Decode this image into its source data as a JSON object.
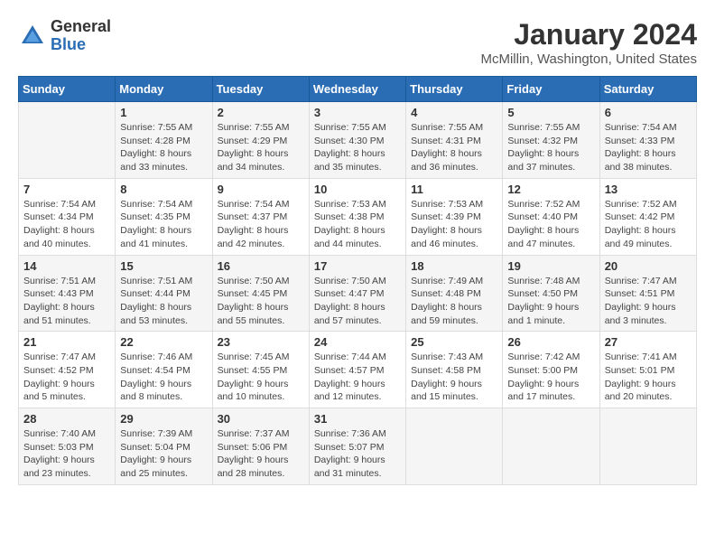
{
  "header": {
    "logo_general": "General",
    "logo_blue": "Blue",
    "title": "January 2024",
    "location": "McMillin, Washington, United States"
  },
  "weekdays": [
    "Sunday",
    "Monday",
    "Tuesday",
    "Wednesday",
    "Thursday",
    "Friday",
    "Saturday"
  ],
  "weeks": [
    [
      {
        "day": "",
        "sunrise": "",
        "sunset": "",
        "daylight": ""
      },
      {
        "day": "1",
        "sunrise": "Sunrise: 7:55 AM",
        "sunset": "Sunset: 4:28 PM",
        "daylight": "Daylight: 8 hours and 33 minutes."
      },
      {
        "day": "2",
        "sunrise": "Sunrise: 7:55 AM",
        "sunset": "Sunset: 4:29 PM",
        "daylight": "Daylight: 8 hours and 34 minutes."
      },
      {
        "day": "3",
        "sunrise": "Sunrise: 7:55 AM",
        "sunset": "Sunset: 4:30 PM",
        "daylight": "Daylight: 8 hours and 35 minutes."
      },
      {
        "day": "4",
        "sunrise": "Sunrise: 7:55 AM",
        "sunset": "Sunset: 4:31 PM",
        "daylight": "Daylight: 8 hours and 36 minutes."
      },
      {
        "day": "5",
        "sunrise": "Sunrise: 7:55 AM",
        "sunset": "Sunset: 4:32 PM",
        "daylight": "Daylight: 8 hours and 37 minutes."
      },
      {
        "day": "6",
        "sunrise": "Sunrise: 7:54 AM",
        "sunset": "Sunset: 4:33 PM",
        "daylight": "Daylight: 8 hours and 38 minutes."
      }
    ],
    [
      {
        "day": "7",
        "sunrise": "Sunrise: 7:54 AM",
        "sunset": "Sunset: 4:34 PM",
        "daylight": "Daylight: 8 hours and 40 minutes."
      },
      {
        "day": "8",
        "sunrise": "Sunrise: 7:54 AM",
        "sunset": "Sunset: 4:35 PM",
        "daylight": "Daylight: 8 hours and 41 minutes."
      },
      {
        "day": "9",
        "sunrise": "Sunrise: 7:54 AM",
        "sunset": "Sunset: 4:37 PM",
        "daylight": "Daylight: 8 hours and 42 minutes."
      },
      {
        "day": "10",
        "sunrise": "Sunrise: 7:53 AM",
        "sunset": "Sunset: 4:38 PM",
        "daylight": "Daylight: 8 hours and 44 minutes."
      },
      {
        "day": "11",
        "sunrise": "Sunrise: 7:53 AM",
        "sunset": "Sunset: 4:39 PM",
        "daylight": "Daylight: 8 hours and 46 minutes."
      },
      {
        "day": "12",
        "sunrise": "Sunrise: 7:52 AM",
        "sunset": "Sunset: 4:40 PM",
        "daylight": "Daylight: 8 hours and 47 minutes."
      },
      {
        "day": "13",
        "sunrise": "Sunrise: 7:52 AM",
        "sunset": "Sunset: 4:42 PM",
        "daylight": "Daylight: 8 hours and 49 minutes."
      }
    ],
    [
      {
        "day": "14",
        "sunrise": "Sunrise: 7:51 AM",
        "sunset": "Sunset: 4:43 PM",
        "daylight": "Daylight: 8 hours and 51 minutes."
      },
      {
        "day": "15",
        "sunrise": "Sunrise: 7:51 AM",
        "sunset": "Sunset: 4:44 PM",
        "daylight": "Daylight: 8 hours and 53 minutes."
      },
      {
        "day": "16",
        "sunrise": "Sunrise: 7:50 AM",
        "sunset": "Sunset: 4:45 PM",
        "daylight": "Daylight: 8 hours and 55 minutes."
      },
      {
        "day": "17",
        "sunrise": "Sunrise: 7:50 AM",
        "sunset": "Sunset: 4:47 PM",
        "daylight": "Daylight: 8 hours and 57 minutes."
      },
      {
        "day": "18",
        "sunrise": "Sunrise: 7:49 AM",
        "sunset": "Sunset: 4:48 PM",
        "daylight": "Daylight: 8 hours and 59 minutes."
      },
      {
        "day": "19",
        "sunrise": "Sunrise: 7:48 AM",
        "sunset": "Sunset: 4:50 PM",
        "daylight": "Daylight: 9 hours and 1 minute."
      },
      {
        "day": "20",
        "sunrise": "Sunrise: 7:47 AM",
        "sunset": "Sunset: 4:51 PM",
        "daylight": "Daylight: 9 hours and 3 minutes."
      }
    ],
    [
      {
        "day": "21",
        "sunrise": "Sunrise: 7:47 AM",
        "sunset": "Sunset: 4:52 PM",
        "daylight": "Daylight: 9 hours and 5 minutes."
      },
      {
        "day": "22",
        "sunrise": "Sunrise: 7:46 AM",
        "sunset": "Sunset: 4:54 PM",
        "daylight": "Daylight: 9 hours and 8 minutes."
      },
      {
        "day": "23",
        "sunrise": "Sunrise: 7:45 AM",
        "sunset": "Sunset: 4:55 PM",
        "daylight": "Daylight: 9 hours and 10 minutes."
      },
      {
        "day": "24",
        "sunrise": "Sunrise: 7:44 AM",
        "sunset": "Sunset: 4:57 PM",
        "daylight": "Daylight: 9 hours and 12 minutes."
      },
      {
        "day": "25",
        "sunrise": "Sunrise: 7:43 AM",
        "sunset": "Sunset: 4:58 PM",
        "daylight": "Daylight: 9 hours and 15 minutes."
      },
      {
        "day": "26",
        "sunrise": "Sunrise: 7:42 AM",
        "sunset": "Sunset: 5:00 PM",
        "daylight": "Daylight: 9 hours and 17 minutes."
      },
      {
        "day": "27",
        "sunrise": "Sunrise: 7:41 AM",
        "sunset": "Sunset: 5:01 PM",
        "daylight": "Daylight: 9 hours and 20 minutes."
      }
    ],
    [
      {
        "day": "28",
        "sunrise": "Sunrise: 7:40 AM",
        "sunset": "Sunset: 5:03 PM",
        "daylight": "Daylight: 9 hours and 23 minutes."
      },
      {
        "day": "29",
        "sunrise": "Sunrise: 7:39 AM",
        "sunset": "Sunset: 5:04 PM",
        "daylight": "Daylight: 9 hours and 25 minutes."
      },
      {
        "day": "30",
        "sunrise": "Sunrise: 7:37 AM",
        "sunset": "Sunset: 5:06 PM",
        "daylight": "Daylight: 9 hours and 28 minutes."
      },
      {
        "day": "31",
        "sunrise": "Sunrise: 7:36 AM",
        "sunset": "Sunset: 5:07 PM",
        "daylight": "Daylight: 9 hours and 31 minutes."
      },
      {
        "day": "",
        "sunrise": "",
        "sunset": "",
        "daylight": ""
      },
      {
        "day": "",
        "sunrise": "",
        "sunset": "",
        "daylight": ""
      },
      {
        "day": "",
        "sunrise": "",
        "sunset": "",
        "daylight": ""
      }
    ]
  ]
}
